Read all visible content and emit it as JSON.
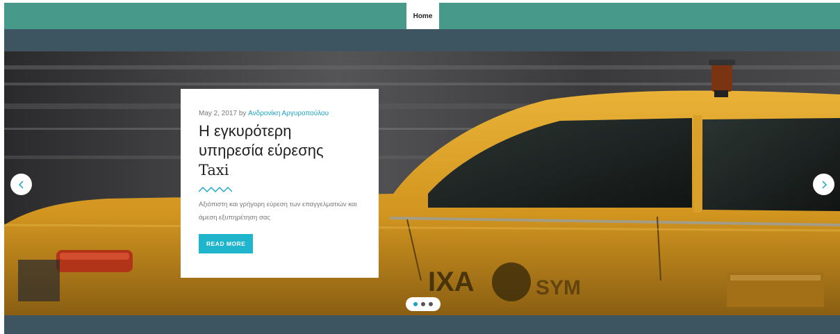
{
  "nav": {
    "home_label": "Home"
  },
  "slide": {
    "date": "May 2, 2017",
    "by": " by ",
    "author": "Ανδρονίκη Αργυροπούλου",
    "title_line1": "Η εγκυρότερη",
    "title_line2": "υπηρεσία εύρεσης",
    "title_line3": "Taxi",
    "excerpt": "Αξιόπιστη και γρήγορη εύρεση των επαγγελματιών και άμεση εξυπηρέτηση σας",
    "read_more": "READ MORE"
  },
  "slider": {
    "slide_count": 3,
    "active_index": 0
  },
  "icons": {
    "prev": "chevron-left-icon",
    "next": "chevron-right-icon",
    "divider": "wavy-line-icon"
  },
  "colors": {
    "nav_bg": "#47998a",
    "frame_bg": "#3d5561",
    "accent": "#1fb5cc",
    "link": "#1aa3c4",
    "taxi_yellow": "#e0a42a"
  }
}
